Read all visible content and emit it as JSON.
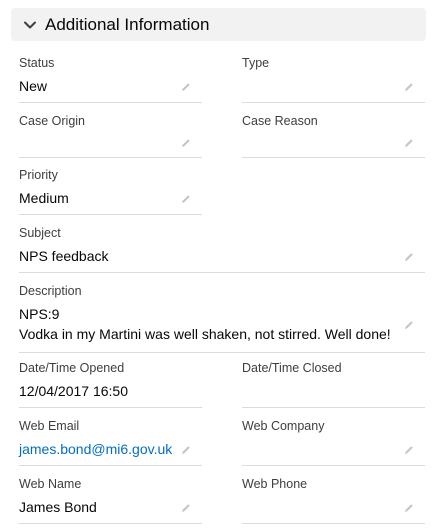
{
  "section": {
    "title": "Additional Information",
    "chevron_icon": "chevron-down-icon"
  },
  "fields": {
    "status": {
      "label": "Status",
      "value": "New"
    },
    "type": {
      "label": "Type",
      "value": ""
    },
    "case_origin": {
      "label": "Case Origin",
      "value": ""
    },
    "case_reason": {
      "label": "Case Reason",
      "value": ""
    },
    "priority": {
      "label": "Priority",
      "value": "Medium"
    },
    "subject": {
      "label": "Subject",
      "value": "NPS feedback"
    },
    "description": {
      "label": "Description",
      "lines": [
        "NPS:9",
        "Vodka in my Martini was well shaken, not stirred. Well done!"
      ]
    },
    "date_opened": {
      "label": "Date/Time Opened",
      "value": "12/04/2017 16:50"
    },
    "date_closed": {
      "label": "Date/Time Closed",
      "value": ""
    },
    "web_email": {
      "label": "Web Email",
      "value": "james.bond@mi6.gov.uk"
    },
    "web_company": {
      "label": "Web Company",
      "value": ""
    },
    "web_name": {
      "label": "Web Name",
      "value": "James Bond"
    },
    "web_phone": {
      "label": "Web Phone",
      "value": ""
    }
  },
  "icons": {
    "edit": "pencil-icon"
  },
  "colors": {
    "link": "#006dcc",
    "label": "#3e3e3c",
    "text": "#080707",
    "header_bg": "#f3f2f2",
    "divider": "#dddbda"
  }
}
